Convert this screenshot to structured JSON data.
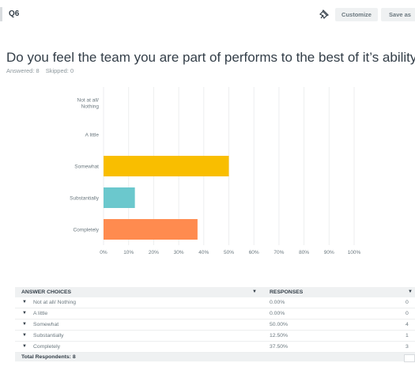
{
  "question_tag": "Q6",
  "toolbar": {
    "customize_label": "Customize",
    "save_as_label": "Save as"
  },
  "question_title": "Do you feel the team you are part of performs to the best of it’s ability",
  "answered_text": "Answered: 8",
  "skipped_text": "Skipped: 0",
  "chart_data": {
    "type": "bar",
    "orientation": "horizontal",
    "categories": [
      "Not at all/ Nothing",
      "A little",
      "Somewhat",
      "Substantially",
      "Completely"
    ],
    "values": [
      0,
      0,
      50,
      12.5,
      37.5
    ],
    "colors": [
      "#00bf6f",
      "#507cb6",
      "#f9be00",
      "#6bc8cd",
      "#ff8b4f"
    ],
    "xticks": [
      "0%",
      "10%",
      "20%",
      "30%",
      "40%",
      "50%",
      "60%",
      "70%",
      "80%",
      "90%",
      "100%"
    ],
    "xlim": [
      0,
      100
    ],
    "grid": true
  },
  "table": {
    "headers": {
      "choices": "ANSWER CHOICES",
      "responses": "RESPONSES"
    },
    "rows": [
      {
        "choice": "Not at all/ Nothing",
        "percent": "0.00%",
        "count": "0"
      },
      {
        "choice": "A little",
        "percent": "0.00%",
        "count": "0"
      },
      {
        "choice": "Somewhat",
        "percent": "50.00%",
        "count": "4"
      },
      {
        "choice": "Substantially",
        "percent": "12.50%",
        "count": "1"
      },
      {
        "choice": "Completely",
        "percent": "37.50%",
        "count": "3"
      }
    ],
    "total_label": "Total Respondents: 8"
  }
}
